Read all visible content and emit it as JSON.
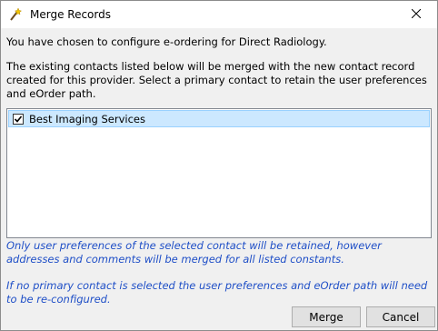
{
  "window": {
    "title": "Merge Records",
    "app_icon": "wand-icon",
    "close_icon": "close-icon"
  },
  "dialog": {
    "intro": "You have chosen to configure e-ordering for Direct Radiology.",
    "description": "The existing contacts listed below will be merged with the new contact record created for this provider. Select a primary contact to retain the user preferences and eOrder path.",
    "contacts": [
      {
        "label": "Best Imaging Services",
        "checked": true
      }
    ],
    "note_retained": "Only user preferences of the selected contact will be retained, however addresses and comments will be merged for all listed constants.",
    "note_reconfigure": "If no primary contact is selected the user preferences and eOrder path will need to be re-configured."
  },
  "buttons": {
    "merge": "Merge",
    "cancel": "Cancel"
  },
  "colors": {
    "note_text": "#1f4fc7",
    "selection_bg": "#cce8ff",
    "selection_border": "#99d1ff"
  }
}
